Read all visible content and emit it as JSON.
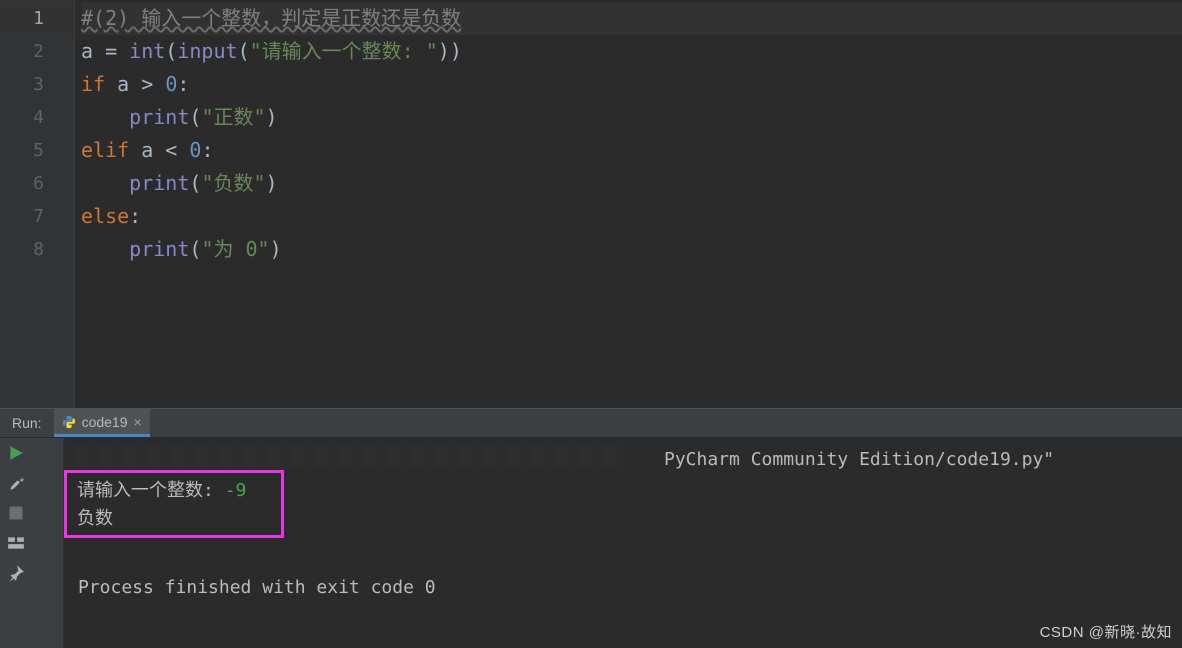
{
  "editor": {
    "gutter": [
      "1",
      "2",
      "3",
      "4",
      "5",
      "6",
      "7",
      "8"
    ],
    "lines": {
      "l1_comment": "#(2) 输入一个整数，判定是正数还是负数",
      "l2_a": "a = ",
      "l2_int": "int",
      "l2_input": "input",
      "l2_str": "\"请输入一个整数: \"",
      "l3_if": "if",
      "l3_cond": " a > ",
      "l3_zero": "0",
      "l3_colon": ":",
      "l4_print": "print",
      "l4_str": "\"正数\"",
      "l5_elif": "elif",
      "l5_cond": " a < ",
      "l5_zero": "0",
      "l5_colon": ":",
      "l6_print": "print",
      "l6_str": "\"负数\"",
      "l7_else": "else",
      "l7_colon": ":",
      "l8_print": "print",
      "l8_str": "\"为 0\""
    }
  },
  "run": {
    "label": "Run:",
    "tab_name": "code19",
    "path_tail": "PyCharm Community Edition/code19.py\"",
    "prompt": "请输入一个整数: ",
    "input_value": "-9",
    "output": "负数",
    "exit": "Process finished with exit code 0"
  },
  "watermark": "CSDN @新晓·故知"
}
